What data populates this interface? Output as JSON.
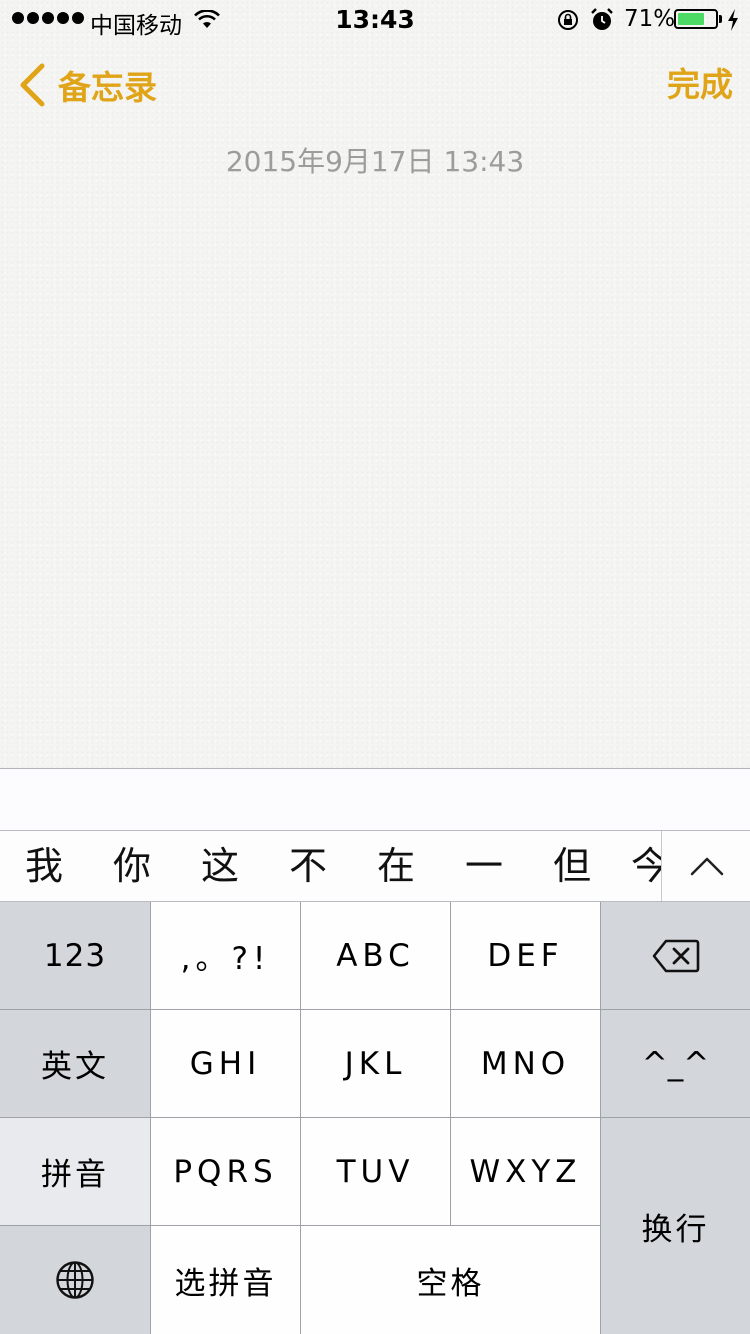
{
  "status_bar": {
    "carrier": "中国移动",
    "time": "13:43",
    "battery_percent": "71%",
    "battery_level": 0.71,
    "battery_color": "#4cd964"
  },
  "nav": {
    "back_label": "备忘录",
    "done_label": "完成",
    "accent_color": "#e0a418"
  },
  "note": {
    "date": "2015年9月17日 13:43"
  },
  "candidates": [
    "我",
    "你",
    "这",
    "不",
    "在",
    "一",
    "但",
    "今"
  ],
  "keyboard": {
    "rows": [
      [
        "123",
        ",。?!",
        "ABC",
        "DEF",
        "delete-icon"
      ],
      [
        "英文",
        "GHI",
        "JKL",
        "MNO",
        "^_^"
      ],
      [
        "拼音",
        "PQRS",
        "TUV",
        "WXYZ",
        "换行"
      ],
      [
        "globe-icon",
        "选拼音",
        "空格"
      ]
    ],
    "k123": "123",
    "punct": ",。?!",
    "abc": "ABC",
    "def": "DEF",
    "english": "英文",
    "ghi": "GHI",
    "jkl": "JKL",
    "mno": "MNO",
    "emoticon": "^_^",
    "pinyin": "拼音",
    "pqrs": "PQRS",
    "tuv": "TUV",
    "wxyz": "WXYZ",
    "return": "换行",
    "select_pinyin": "选拼音",
    "space": "空格"
  }
}
